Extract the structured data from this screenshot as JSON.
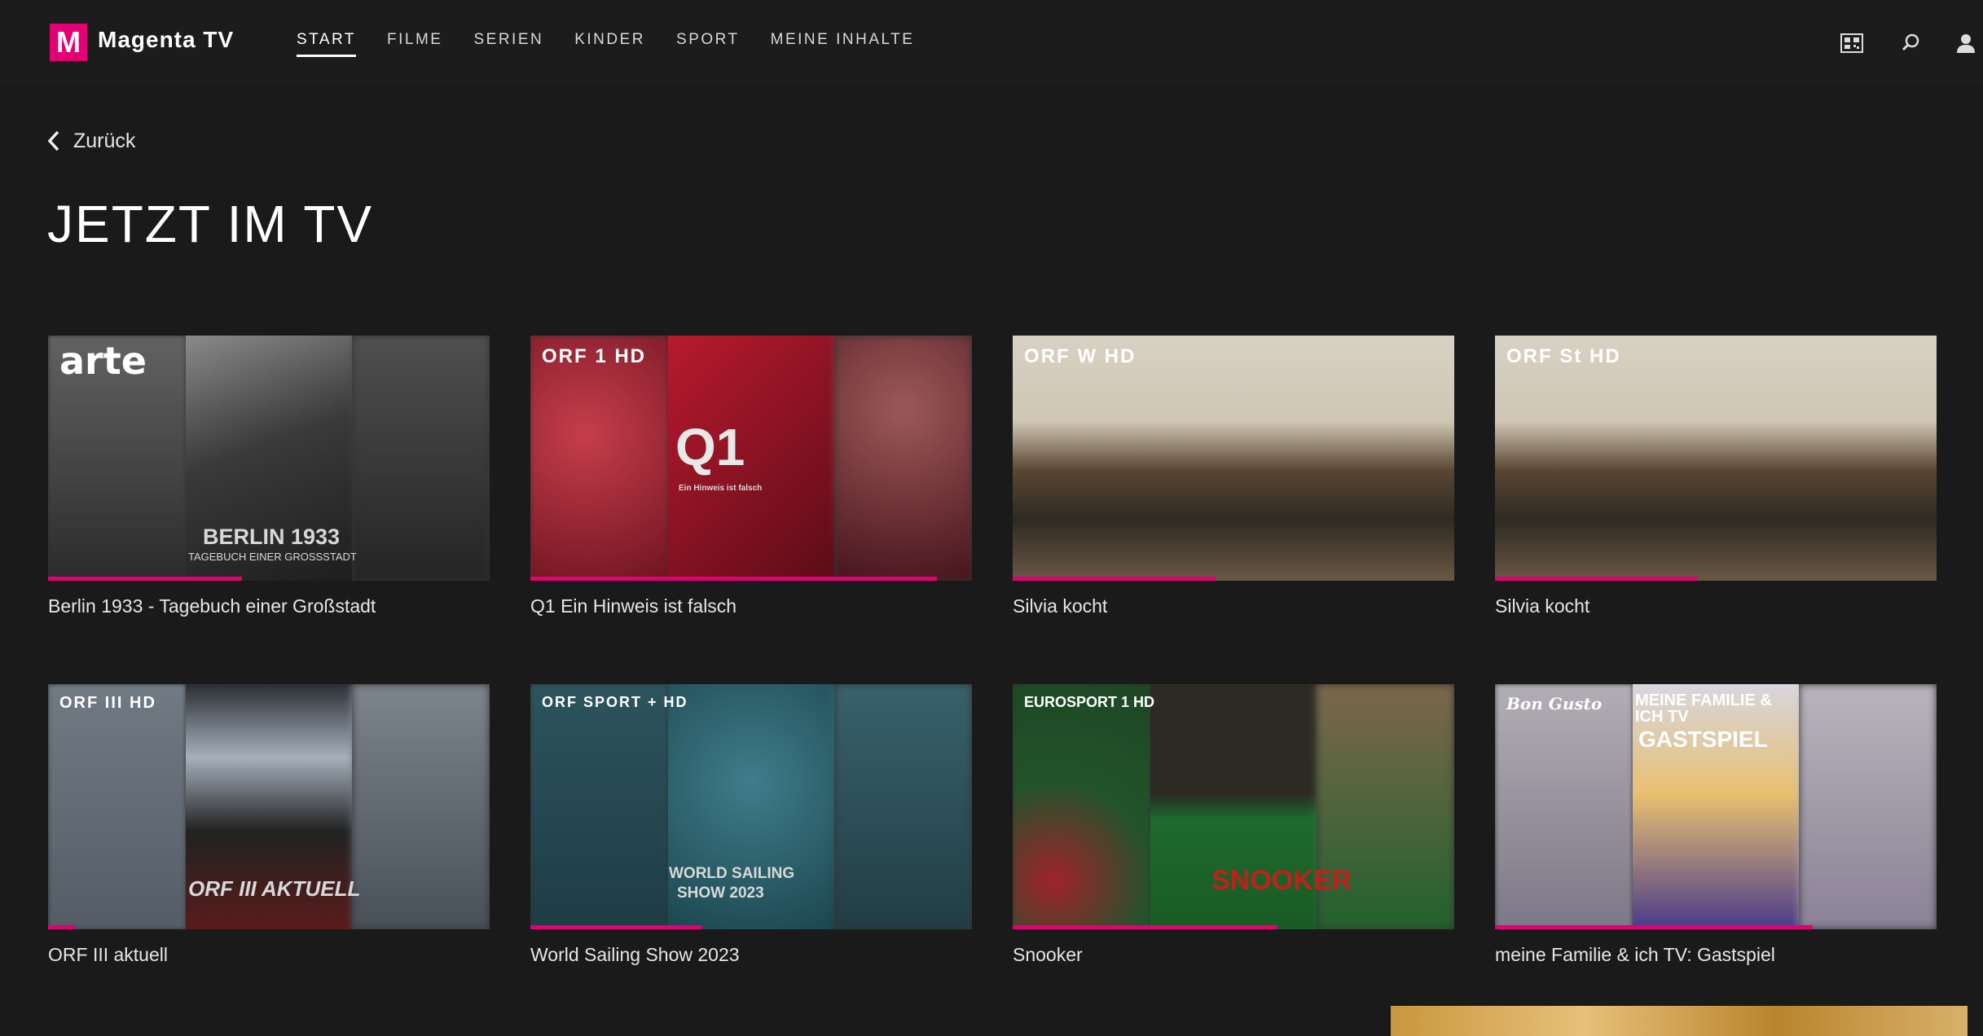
{
  "header": {
    "logo_letter": "M",
    "brand": "Magenta TV",
    "nav": [
      "START",
      "FILME",
      "SERIEN",
      "KINDER",
      "SPORT",
      "MEINE INHALTE"
    ],
    "active_nav": "START",
    "icons": [
      "remote-qr-icon",
      "search-icon",
      "user-icon"
    ]
  },
  "back_label": "Zurück",
  "page_title": "JETZT IM TV",
  "cards": [
    {
      "title": "Berlin 1933 - Tagebuch einer Großstadt",
      "channel": "arte",
      "progress": 0.44,
      "overlay": "BERLIN 1933",
      "overlay_sub": "TAGEBUCH EINER GROSSSTADT"
    },
    {
      "title": "Q1 Ein Hinweis ist falsch",
      "channel": "ORF 1 HD",
      "progress": 0.92,
      "overlay": "Q1",
      "overlay_sub": "Ein Hinweis ist falsch"
    },
    {
      "title": "Silvia kocht",
      "channel": "ORF W HD",
      "progress": 0.46,
      "overlay": "",
      "overlay_sub": ""
    },
    {
      "title": "Silvia kocht",
      "channel": "ORF St HD",
      "progress": 0.46,
      "overlay": "",
      "overlay_sub": ""
    },
    {
      "title": "ORF III aktuell",
      "channel": "ORF III HD",
      "progress": 0.06,
      "overlay": "ORF III AKTUELL",
      "overlay_sub": ""
    },
    {
      "title": "World Sailing Show 2023",
      "channel": "ORF SPORT + HD",
      "progress": 0.39,
      "overlay": "WORLD SAILING",
      "overlay_sub": "SHOW 2023"
    },
    {
      "title": "Snooker",
      "channel": "EUROSPORT 1 HD",
      "progress": 0.6,
      "overlay": "SNOOKER",
      "overlay_sub": ""
    },
    {
      "title": "meine Familie & ich TV: Gastspiel",
      "channel": "Bon Gusto",
      "progress": 0.72,
      "overlay": "MEINE FAMILIE & ICH TV",
      "overlay_sub": "GASTSPIEL"
    }
  ],
  "colors": {
    "accent": "#e20074",
    "background": "#1a1a1a"
  }
}
